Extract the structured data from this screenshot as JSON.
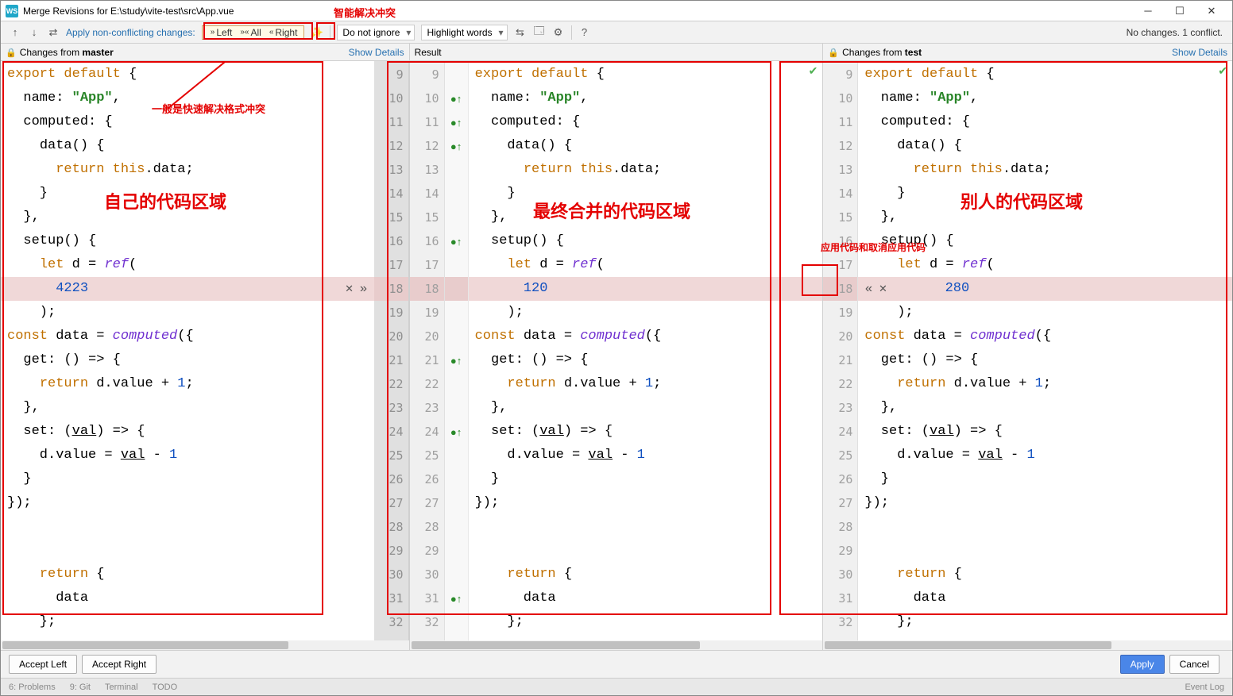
{
  "title": "Merge Revisions for E:\\study\\vite-test\\src\\App.vue",
  "toolbar": {
    "apply_non_conflicting": "Apply non-conflicting changes:",
    "left": "Left",
    "all": "All",
    "right": "Right",
    "ignore_select": "Do not ignore",
    "highlight_select": "Highlight words",
    "status": "No changes. 1 conflict."
  },
  "annotations": {
    "top_magic": "智能解决冲突",
    "quick_format": "一般是快速解决格式冲突",
    "own_code": "自己的代码区域",
    "merged_code": "最终合并的代码区域",
    "other_code": "别人的代码区域",
    "apply_cancel": "应用代码和取消应用代码"
  },
  "subheader": {
    "left_prefix": "Changes from ",
    "left_branch": "master",
    "middle": "Result",
    "right_prefix": "Changes from ",
    "right_branch": "test",
    "show_details": "Show Details"
  },
  "code": {
    "left_lines": [
      {
        "n": 9,
        "t": "export default {",
        "cls": "",
        "styled": [
          [
            "export default",
            "kw"
          ],
          [
            " {",
            ""
          ]
        ]
      },
      {
        "n": 10,
        "t": "  name: \"App\",",
        "styled": [
          [
            "  name: ",
            ""
          ],
          [
            "\"App\"",
            "str"
          ],
          [
            ",",
            ""
          ]
        ]
      },
      {
        "n": 11,
        "t": "  computed: {",
        "styled": [
          [
            "  computed: {",
            ""
          ]
        ]
      },
      {
        "n": 12,
        "t": "    data() {",
        "styled": [
          [
            "    ",
            ""
          ],
          [
            "data",
            ""
          ],
          [
            "() {",
            ""
          ]
        ]
      },
      {
        "n": 13,
        "t": "      return this.data;",
        "styled": [
          [
            "      ",
            ""
          ],
          [
            "return ",
            "kw"
          ],
          [
            "this",
            "kw"
          ],
          [
            ".data;",
            ""
          ]
        ]
      },
      {
        "n": 14,
        "t": "    }",
        "styled": [
          [
            "    }",
            ""
          ]
        ]
      },
      {
        "n": 15,
        "t": "  },",
        "styled": [
          [
            "  },",
            ""
          ]
        ]
      },
      {
        "n": 16,
        "t": "  setup() {",
        "styled": [
          [
            "  ",
            ""
          ],
          [
            "setup",
            ""
          ],
          [
            "() {",
            ""
          ]
        ]
      },
      {
        "n": 17,
        "t": "    let d = ref(",
        "styled": [
          [
            "    ",
            ""
          ],
          [
            "let ",
            "kw"
          ],
          [
            "d = ",
            ""
          ],
          [
            "ref",
            "fn ital"
          ],
          [
            "(",
            ""
          ]
        ]
      },
      {
        "n": 18,
        "t": "      4223",
        "cls": "conflict-line",
        "styled": [
          [
            "      ",
            ""
          ],
          [
            "4223",
            "num"
          ]
        ]
      },
      {
        "n": 19,
        "t": "    );",
        "styled": [
          [
            "    );",
            ""
          ]
        ]
      },
      {
        "n": 20,
        "t": "const data = computed({",
        "styled": [
          [
            "",
            ""
          ],
          [
            "const ",
            "kw"
          ],
          [
            "data = ",
            ""
          ],
          [
            "computed",
            "fn ital"
          ],
          [
            "({",
            ""
          ]
        ]
      },
      {
        "n": 21,
        "t": "  get: () => {",
        "styled": [
          [
            "  get: () => {",
            ""
          ]
        ]
      },
      {
        "n": 22,
        "t": "    return d.value + 1;",
        "styled": [
          [
            "    ",
            ""
          ],
          [
            "return ",
            "kw"
          ],
          [
            "d.value + ",
            ""
          ],
          [
            "1",
            "num"
          ],
          [
            ";",
            ""
          ]
        ]
      },
      {
        "n": 23,
        "t": "  },",
        "styled": [
          [
            "  },",
            ""
          ]
        ]
      },
      {
        "n": 24,
        "t": "  set: (val) => {",
        "styled": [
          [
            "  set: (",
            ""
          ],
          [
            "val",
            "under"
          ],
          [
            ") => {",
            ""
          ]
        ]
      },
      {
        "n": 25,
        "t": "    d.value = val - 1",
        "styled": [
          [
            "    d.value = ",
            ""
          ],
          [
            "val",
            "under"
          ],
          [
            " - ",
            ""
          ],
          [
            "1",
            "num"
          ]
        ]
      },
      {
        "n": 26,
        "t": "  }",
        "styled": [
          [
            "  }",
            ""
          ]
        ]
      },
      {
        "n": 27,
        "t": "});",
        "styled": [
          [
            "});",
            ""
          ]
        ]
      },
      {
        "n": 28,
        "t": "",
        "styled": [
          [
            "",
            ""
          ]
        ]
      },
      {
        "n": 29,
        "t": "",
        "styled": [
          [
            "",
            ""
          ]
        ]
      },
      {
        "n": 30,
        "t": "    return {",
        "styled": [
          [
            "    ",
            ""
          ],
          [
            "return ",
            "kw"
          ],
          [
            "{",
            ""
          ]
        ]
      },
      {
        "n": 31,
        "t": "      data",
        "styled": [
          [
            "      data",
            ""
          ]
        ]
      },
      {
        "n": 32,
        "t": "    };",
        "styled": [
          [
            "    };",
            ""
          ]
        ]
      }
    ],
    "middle_lines": [
      {
        "n": 9,
        "t": "export default {",
        "styled": [
          [
            "export default",
            "kw"
          ],
          [
            " {",
            ""
          ]
        ],
        "mk": ""
      },
      {
        "n": 10,
        "t": "  name: \"App\",",
        "styled": [
          [
            "  name: ",
            ""
          ],
          [
            "\"App\"",
            "str"
          ],
          [
            ",",
            ""
          ]
        ],
        "mk": "●↑"
      },
      {
        "n": 11,
        "t": "  computed: {",
        "styled": [
          [
            "  computed: {",
            ""
          ]
        ],
        "mk": "●↑"
      },
      {
        "n": 12,
        "t": "    data() {",
        "styled": [
          [
            "    ",
            ""
          ],
          [
            "data",
            ""
          ],
          [
            "() {",
            ""
          ]
        ],
        "mk": "●↑"
      },
      {
        "n": 13,
        "t": "      return this.data;",
        "styled": [
          [
            "      ",
            ""
          ],
          [
            "return ",
            "kw"
          ],
          [
            "this",
            "kw"
          ],
          [
            ".data;",
            ""
          ]
        ],
        "mk": ""
      },
      {
        "n": 14,
        "t": "    }",
        "styled": [
          [
            "    }",
            ""
          ]
        ],
        "mk": ""
      },
      {
        "n": 15,
        "t": "  },",
        "styled": [
          [
            "  },",
            ""
          ]
        ],
        "mk": ""
      },
      {
        "n": 16,
        "t": "  setup() {",
        "styled": [
          [
            "  ",
            ""
          ],
          [
            "setup",
            ""
          ],
          [
            "() {",
            ""
          ]
        ],
        "mk": "●↑"
      },
      {
        "n": 17,
        "t": "    let d = ref(",
        "styled": [
          [
            "    ",
            ""
          ],
          [
            "let ",
            "kw"
          ],
          [
            "d = ",
            ""
          ],
          [
            "ref",
            "fn ital"
          ],
          [
            "(",
            ""
          ]
        ],
        "mk": ""
      },
      {
        "n": 18,
        "t": "      120",
        "cls": "conflict-line",
        "styled": [
          [
            "      ",
            ""
          ],
          [
            "120",
            "num"
          ]
        ],
        "mk": ""
      },
      {
        "n": 19,
        "t": "    );",
        "styled": [
          [
            "    );",
            ""
          ]
        ],
        "mk": ""
      },
      {
        "n": 20,
        "t": "const data = computed({",
        "styled": [
          [
            "",
            ""
          ],
          [
            "const ",
            "kw"
          ],
          [
            "data = ",
            ""
          ],
          [
            "computed",
            "fn ital"
          ],
          [
            "({",
            ""
          ]
        ],
        "mk": ""
      },
      {
        "n": 21,
        "t": "  get: () => {",
        "styled": [
          [
            "  get: () => {",
            ""
          ]
        ],
        "mk": "●↑"
      },
      {
        "n": 22,
        "t": "    return d.value + 1;",
        "styled": [
          [
            "    ",
            ""
          ],
          [
            "return ",
            "kw"
          ],
          [
            "d.value + ",
            ""
          ],
          [
            "1",
            "num"
          ],
          [
            ";",
            ""
          ]
        ],
        "mk": ""
      },
      {
        "n": 23,
        "t": "  },",
        "styled": [
          [
            "  },",
            ""
          ]
        ],
        "mk": ""
      },
      {
        "n": 24,
        "t": "  set: (val) => {",
        "styled": [
          [
            "  set: (",
            ""
          ],
          [
            "val",
            "under"
          ],
          [
            ") => {",
            ""
          ]
        ],
        "mk": "●↑"
      },
      {
        "n": 25,
        "t": "    d.value = val - 1",
        "styled": [
          [
            "    d.value = ",
            ""
          ],
          [
            "val",
            "under"
          ],
          [
            " - ",
            ""
          ],
          [
            "1",
            "num"
          ]
        ],
        "mk": ""
      },
      {
        "n": 26,
        "t": "  }",
        "styled": [
          [
            "  }",
            ""
          ]
        ],
        "mk": ""
      },
      {
        "n": 27,
        "t": "});",
        "styled": [
          [
            "});",
            ""
          ]
        ],
        "mk": ""
      },
      {
        "n": 28,
        "t": "",
        "styled": [
          [
            "",
            ""
          ]
        ],
        "mk": ""
      },
      {
        "n": 29,
        "t": "",
        "styled": [
          [
            "",
            ""
          ]
        ],
        "mk": ""
      },
      {
        "n": 30,
        "t": "    return {",
        "styled": [
          [
            "    ",
            ""
          ],
          [
            "return ",
            "kw"
          ],
          [
            "{",
            ""
          ]
        ],
        "mk": ""
      },
      {
        "n": 31,
        "t": "      data",
        "styled": [
          [
            "      data",
            ""
          ]
        ],
        "mk": "●↑"
      },
      {
        "n": 32,
        "t": "    };",
        "styled": [
          [
            "    };",
            ""
          ]
        ],
        "mk": ""
      }
    ],
    "right_lines": [
      {
        "n": 9,
        "t": "export default {",
        "styled": [
          [
            "export default",
            "kw"
          ],
          [
            " {",
            ""
          ]
        ]
      },
      {
        "n": 10,
        "t": "  name: \"App\",",
        "styled": [
          [
            "  name: ",
            ""
          ],
          [
            "\"App\"",
            "str"
          ],
          [
            ",",
            ""
          ]
        ]
      },
      {
        "n": 11,
        "t": "  computed: {",
        "styled": [
          [
            "  computed: {",
            ""
          ]
        ]
      },
      {
        "n": 12,
        "t": "    data() {",
        "styled": [
          [
            "    ",
            ""
          ],
          [
            "data",
            ""
          ],
          [
            "() {",
            ""
          ]
        ]
      },
      {
        "n": 13,
        "t": "      return this.data;",
        "styled": [
          [
            "      ",
            ""
          ],
          [
            "return ",
            "kw"
          ],
          [
            "this",
            "kw"
          ],
          [
            ".data;",
            ""
          ]
        ]
      },
      {
        "n": 14,
        "t": "    }",
        "styled": [
          [
            "    }",
            ""
          ]
        ]
      },
      {
        "n": 15,
        "t": "  },",
        "styled": [
          [
            "  },",
            ""
          ]
        ]
      },
      {
        "n": 16,
        "t": "  setup() {",
        "styled": [
          [
            "  ",
            ""
          ],
          [
            "setup",
            ""
          ],
          [
            "() {",
            ""
          ]
        ]
      },
      {
        "n": 17,
        "t": "    let d = ref(",
        "styled": [
          [
            "    ",
            ""
          ],
          [
            "let ",
            "kw"
          ],
          [
            "d = ",
            ""
          ],
          [
            "ref",
            "fn ital"
          ],
          [
            "(",
            ""
          ]
        ]
      },
      {
        "n": 18,
        "t": "      280",
        "cls": "conflict-line",
        "styled": [
          [
            "      ",
            ""
          ],
          [
            "280",
            "num"
          ]
        ]
      },
      {
        "n": 19,
        "t": "    );",
        "styled": [
          [
            "    );",
            ""
          ]
        ]
      },
      {
        "n": 20,
        "t": "const data = computed({",
        "styled": [
          [
            "",
            ""
          ],
          [
            "const ",
            "kw"
          ],
          [
            "data = ",
            ""
          ],
          [
            "computed",
            "fn ital"
          ],
          [
            "({",
            ""
          ]
        ]
      },
      {
        "n": 21,
        "t": "  get: () => {",
        "styled": [
          [
            "  get: () => {",
            ""
          ]
        ]
      },
      {
        "n": 22,
        "t": "    return d.value + 1;",
        "styled": [
          [
            "    ",
            ""
          ],
          [
            "return ",
            "kw"
          ],
          [
            "d.value + ",
            ""
          ],
          [
            "1",
            "num"
          ],
          [
            ";",
            ""
          ]
        ]
      },
      {
        "n": 23,
        "t": "  },",
        "styled": [
          [
            "  },",
            ""
          ]
        ]
      },
      {
        "n": 24,
        "t": "  set: (val) => {",
        "styled": [
          [
            "  set: (",
            ""
          ],
          [
            "val",
            "under"
          ],
          [
            ") => {",
            ""
          ]
        ]
      },
      {
        "n": 25,
        "t": "    d.value = val - 1",
        "styled": [
          [
            "    d.value = ",
            ""
          ],
          [
            "val",
            "under"
          ],
          [
            " - ",
            ""
          ],
          [
            "1",
            "num"
          ]
        ]
      },
      {
        "n": 26,
        "t": "  }",
        "styled": [
          [
            "  }",
            ""
          ]
        ]
      },
      {
        "n": 27,
        "t": "});",
        "styled": [
          [
            "});",
            ""
          ]
        ]
      },
      {
        "n": 28,
        "t": "",
        "styled": [
          [
            "",
            ""
          ]
        ]
      },
      {
        "n": 29,
        "t": "",
        "styled": [
          [
            "",
            ""
          ]
        ]
      },
      {
        "n": 30,
        "t": "    return {",
        "styled": [
          [
            "    ",
            ""
          ],
          [
            "return ",
            "kw"
          ],
          [
            "{",
            ""
          ]
        ]
      },
      {
        "n": 31,
        "t": "      data",
        "styled": [
          [
            "      data",
            ""
          ]
        ]
      },
      {
        "n": 32,
        "t": "    };",
        "styled": [
          [
            "    };",
            ""
          ]
        ]
      }
    ]
  },
  "footer": {
    "accept_left": "Accept Left",
    "accept_right": "Accept Right",
    "apply": "Apply",
    "cancel": "Cancel"
  },
  "statusbar": {
    "problems": "6: Problems",
    "git": "9: Git",
    "terminal": "Terminal",
    "todo": "TODO",
    "eventlog": "Event Log"
  }
}
